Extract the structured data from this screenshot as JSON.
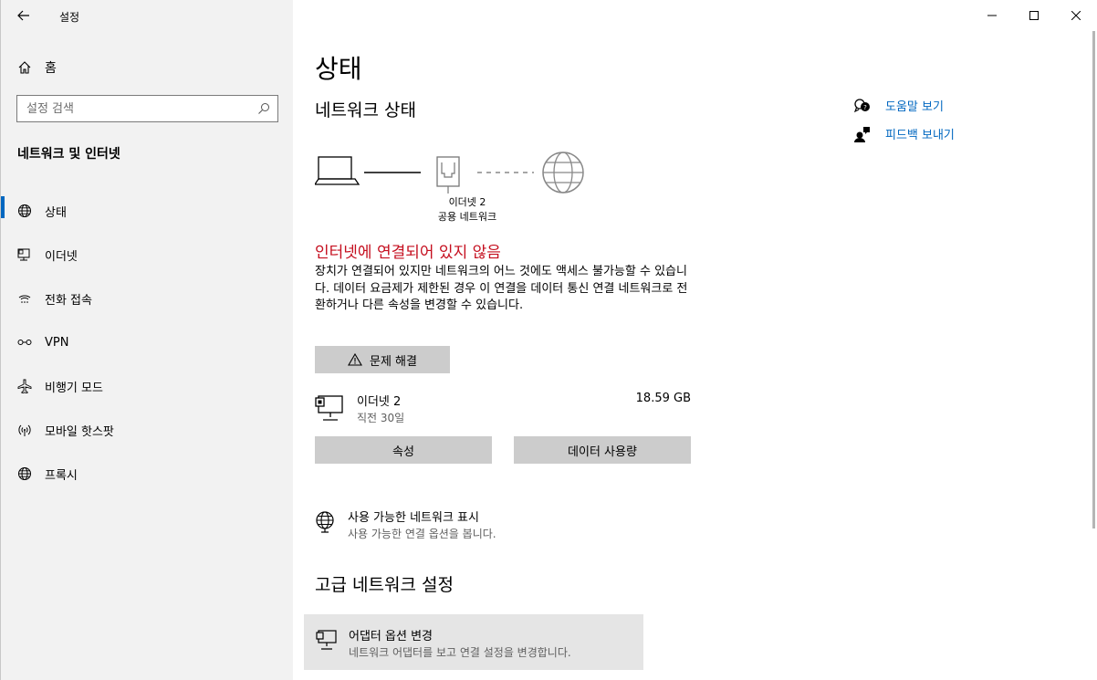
{
  "window": {
    "title": "설정"
  },
  "sidebar": {
    "home_label": "홈",
    "search_placeholder": "설정 검색",
    "section_title": "네트워크 및 인터넷",
    "items": [
      {
        "label": "상태",
        "icon": "globe-icon",
        "active": true
      },
      {
        "label": "이더넷",
        "icon": "ethernet-icon"
      },
      {
        "label": "전화 접속",
        "icon": "dialup-icon"
      },
      {
        "label": "VPN",
        "icon": "vpn-icon"
      },
      {
        "label": "비행기 모드",
        "icon": "airplane-icon"
      },
      {
        "label": "모바일 핫스팟",
        "icon": "hotspot-icon"
      },
      {
        "label": "프록시",
        "icon": "globe-icon"
      }
    ]
  },
  "main": {
    "page_title": "상태",
    "network_status_title": "네트워크 상태",
    "diagram": {
      "adapter_name": "이더넷 2",
      "network_type": "공용 네트워크"
    },
    "alert_title": "인터넷에 연결되어 있지 않음",
    "description": "장치가 연결되어 있지만 네트워크의 어느 것에도 액세스 불가능할 수 있습니다. 데이터 요금제가 제한된 경우 이 연결을 데이터 통신 연결 네트워크로 전환하거나 다른 속성을 변경할 수 있습니다.",
    "troubleshoot_label": "문제 해결",
    "connection": {
      "name": "이더넷 2",
      "time": "직전 30일",
      "size": "18.59 GB"
    },
    "properties_label": "속성",
    "data_usage_label": "데이터 사용량",
    "show_networks": {
      "title": "사용 가능한 네트워크 표시",
      "subtitle": "사용 가능한 연결 옵션을 봅니다."
    },
    "advanced_title": "고급 네트워크 설정",
    "adapter_options": {
      "title": "어댑터 옵션 변경",
      "subtitle": "네트워크 어댑터를 보고 연결 설정을 변경합니다."
    }
  },
  "help": {
    "get_help_label": "도움말 보기",
    "feedback_label": "피드백 보내기"
  },
  "colors": {
    "accent": "#0067c0",
    "error": "#c50f1f",
    "sidebar_bg": "#f2f2f2",
    "button_bg": "#cccccc"
  }
}
